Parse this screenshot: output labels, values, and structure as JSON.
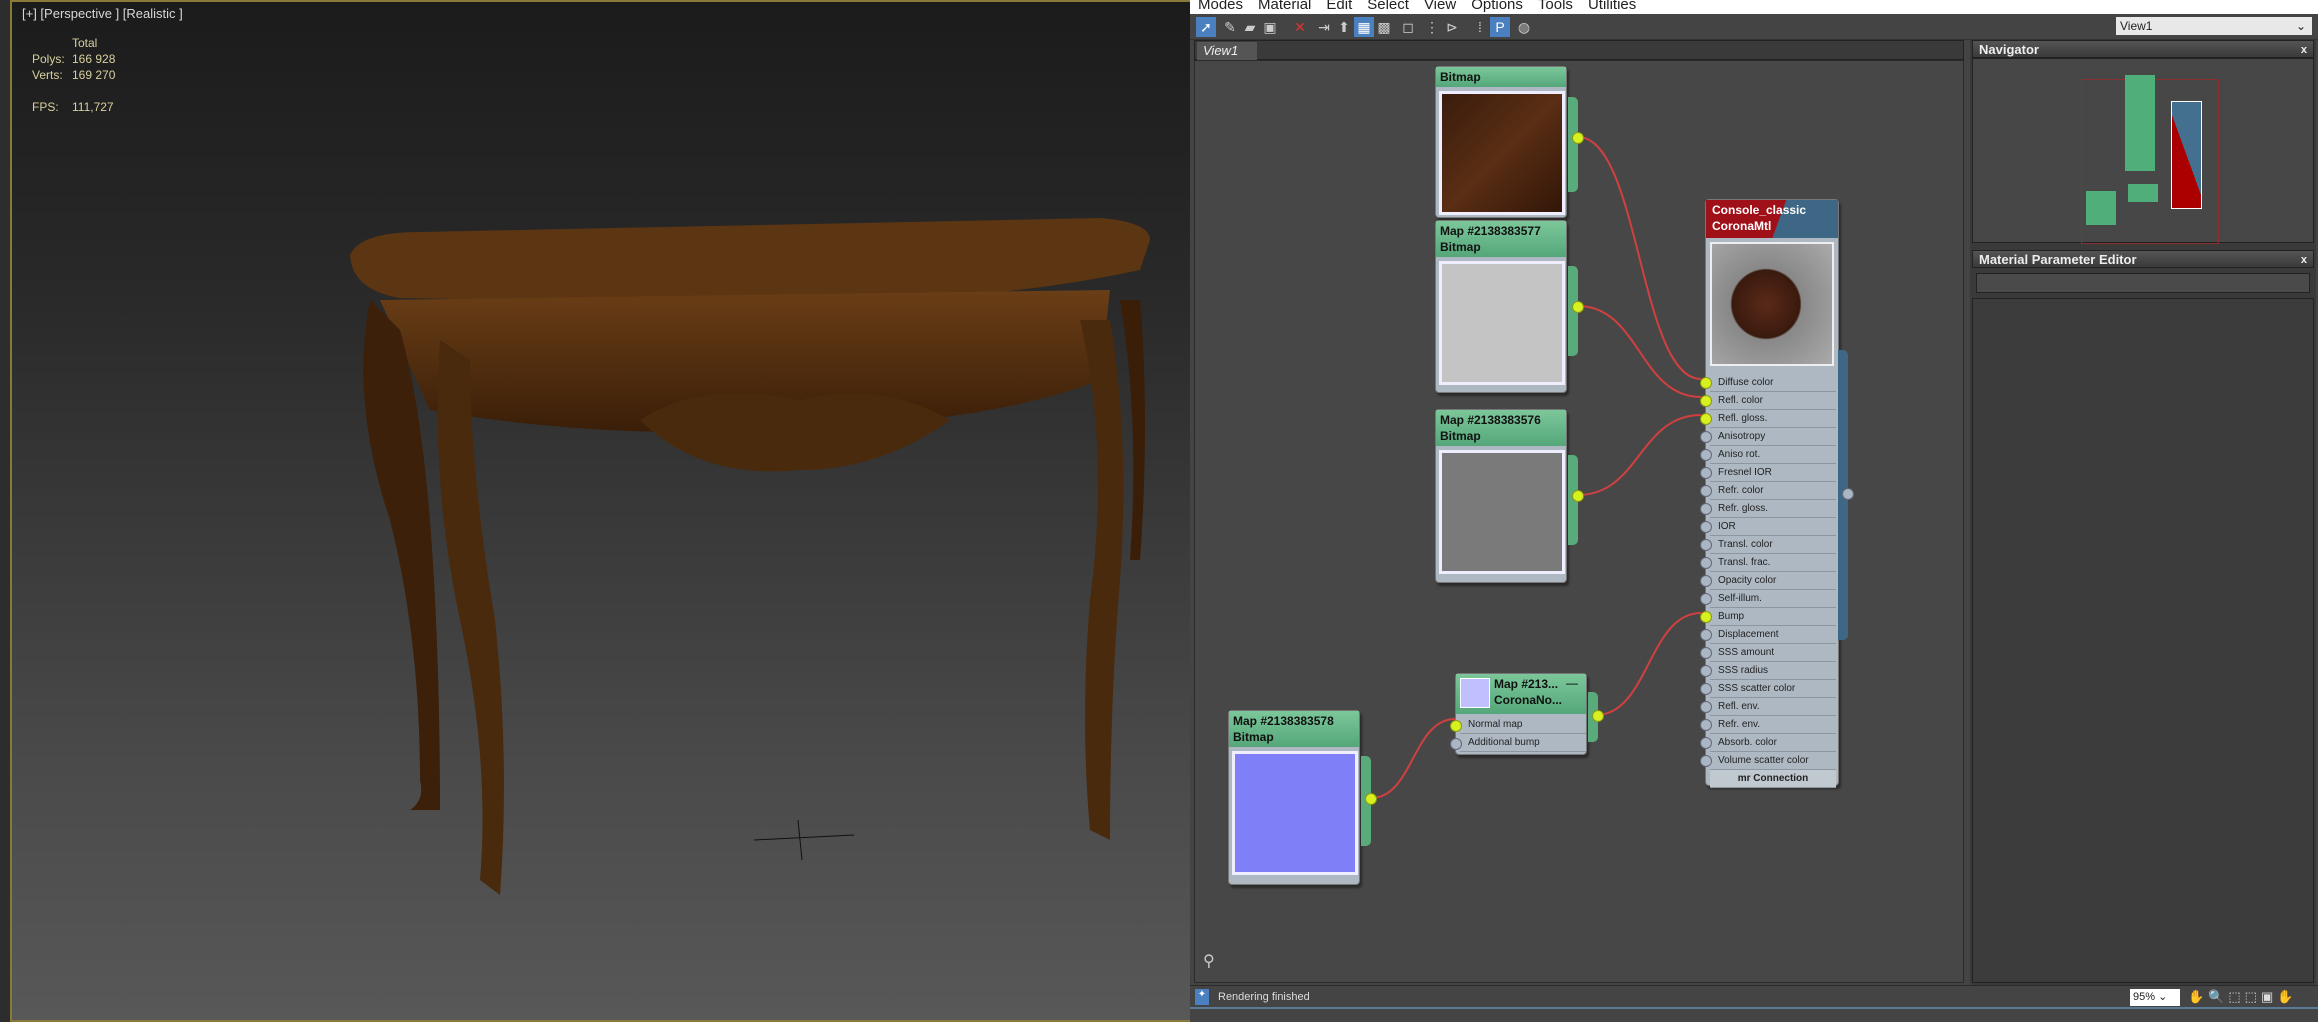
{
  "viewport": {
    "label": "[+] [Perspective ] [Realistic ]",
    "stats_header": "Total",
    "polys_label": "Polys:",
    "polys": "166 928",
    "verts_label": "Verts:",
    "verts": "169 270",
    "fps_label": "FPS:",
    "fps": "111,727"
  },
  "menu": [
    "Modes",
    "Material",
    "Edit",
    "Select",
    "View",
    "Options",
    "Tools",
    "Utilities"
  ],
  "view_select": "View1",
  "tab": "View1",
  "nodes": {
    "bitmap1": {
      "type": "Bitmap"
    },
    "bitmap2": {
      "title": "Map #2138383577",
      "type": "Bitmap"
    },
    "bitmap3": {
      "title": "Map #2138383576",
      "type": "Bitmap"
    },
    "bitmap4": {
      "title": "Map #2138383578",
      "type": "Bitmap"
    },
    "normal": {
      "title": "Map #213...",
      "type": "CoronaNo...",
      "inputs": [
        "Normal map",
        "Additional bump"
      ]
    },
    "material": {
      "title": "Console_classic",
      "type": "CoronaMtl",
      "footer": "mr Connection",
      "inputs": [
        "Diffuse color",
        "Refl. color",
        "Refl. gloss.",
        "Anisotropy",
        "Aniso rot.",
        "Fresnel IOR",
        "Refr. color",
        "Refr. gloss.",
        "IOR",
        "Transl. color",
        "Transl. frac.",
        "Opacity color",
        "Self-illum.",
        "Bump",
        "Displacement",
        "SSS amount",
        "SSS radius",
        "SSS scatter color",
        "Refl. env.",
        "Refr. env.",
        "Absorb. color",
        "Volume scatter color"
      ],
      "connected": [
        "Diffuse color",
        "Refl. color",
        "Refl. gloss.",
        "Bump"
      ]
    }
  },
  "navigator": {
    "title": "Navigator"
  },
  "param_editor": {
    "title": "Material Parameter Editor"
  },
  "status": {
    "text": "Rendering finished",
    "zoom": "95%"
  },
  "colors": {
    "socket_connected": "#d7f020",
    "wire": "#d04040",
    "map_node": "#5aab7c",
    "material_header": "#a01018"
  }
}
